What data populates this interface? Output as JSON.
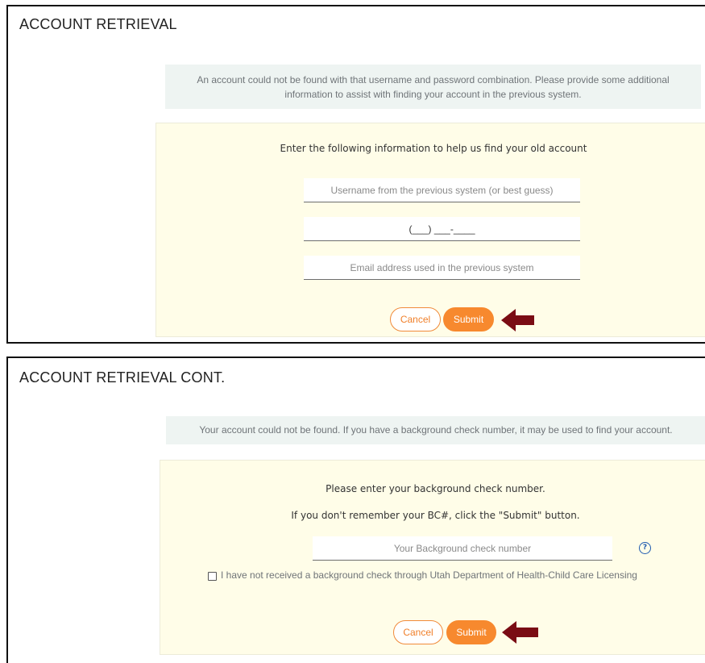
{
  "panel1": {
    "title": "ACCOUNT RETRIEVAL",
    "info": "An account could not be found with that username and password combination. Please provide some additional information to assist with finding your account in the previous system.",
    "heading": "Enter the following information to help us find your old account",
    "username_placeholder": "Username from the previous system (or best guess)",
    "phone_value": "(___) ___-____",
    "email_placeholder": "Email address used in the previous system",
    "cancel_label": "Cancel",
    "submit_label": "Submit"
  },
  "panel2": {
    "title": "ACCOUNT RETRIEVAL CONT.",
    "info": "Your account could not be found. If you have a background check number, it may be used to find your account.",
    "heading_line1": "Please enter your background check number.",
    "heading_line2": "If you don't remember your BC#, click the \"Submit\" button.",
    "bc_placeholder": "Your Background check number",
    "help_icon": "?",
    "checkbox_label": "I have not received a background check through Utah Department of Health-Child Care Licensing",
    "cancel_label": "Cancel",
    "submit_label": "Submit"
  },
  "colors": {
    "accent": "#f7892e",
    "arrow": "#7a0c14",
    "info_bg": "#eef4f2",
    "form_bg": "#fffde8"
  }
}
